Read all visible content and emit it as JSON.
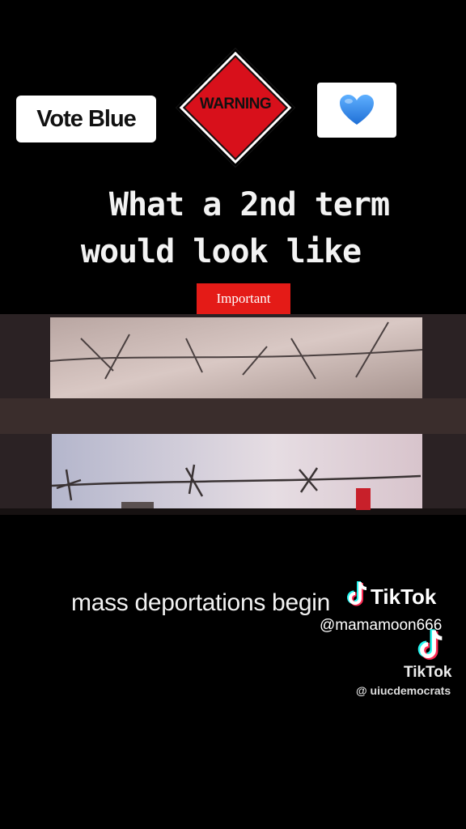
{
  "badges": {
    "vote_label": "Vote Blue",
    "warning_label": "WARNING",
    "heart_icon": "blue-heart-icon",
    "heart_emoji": "💙"
  },
  "headline": {
    "line1": "What a 2nd term",
    "line2": "would look like"
  },
  "important_label": "Important",
  "video": {
    "caption": "mass deportations begin"
  },
  "watermarks": [
    {
      "brand": "TikTok",
      "handle": "@mamamoon666"
    },
    {
      "brand": "TikTok",
      "handle": "@ uiucdemocrats"
    }
  ],
  "colors": {
    "background": "#000000",
    "warning_red": "#d8101b",
    "important_red": "#e41b17",
    "heart_blue": "#3b8fe8",
    "tiktok_cyan": "#25f4ee",
    "tiktok_pink": "#fe2c55"
  }
}
